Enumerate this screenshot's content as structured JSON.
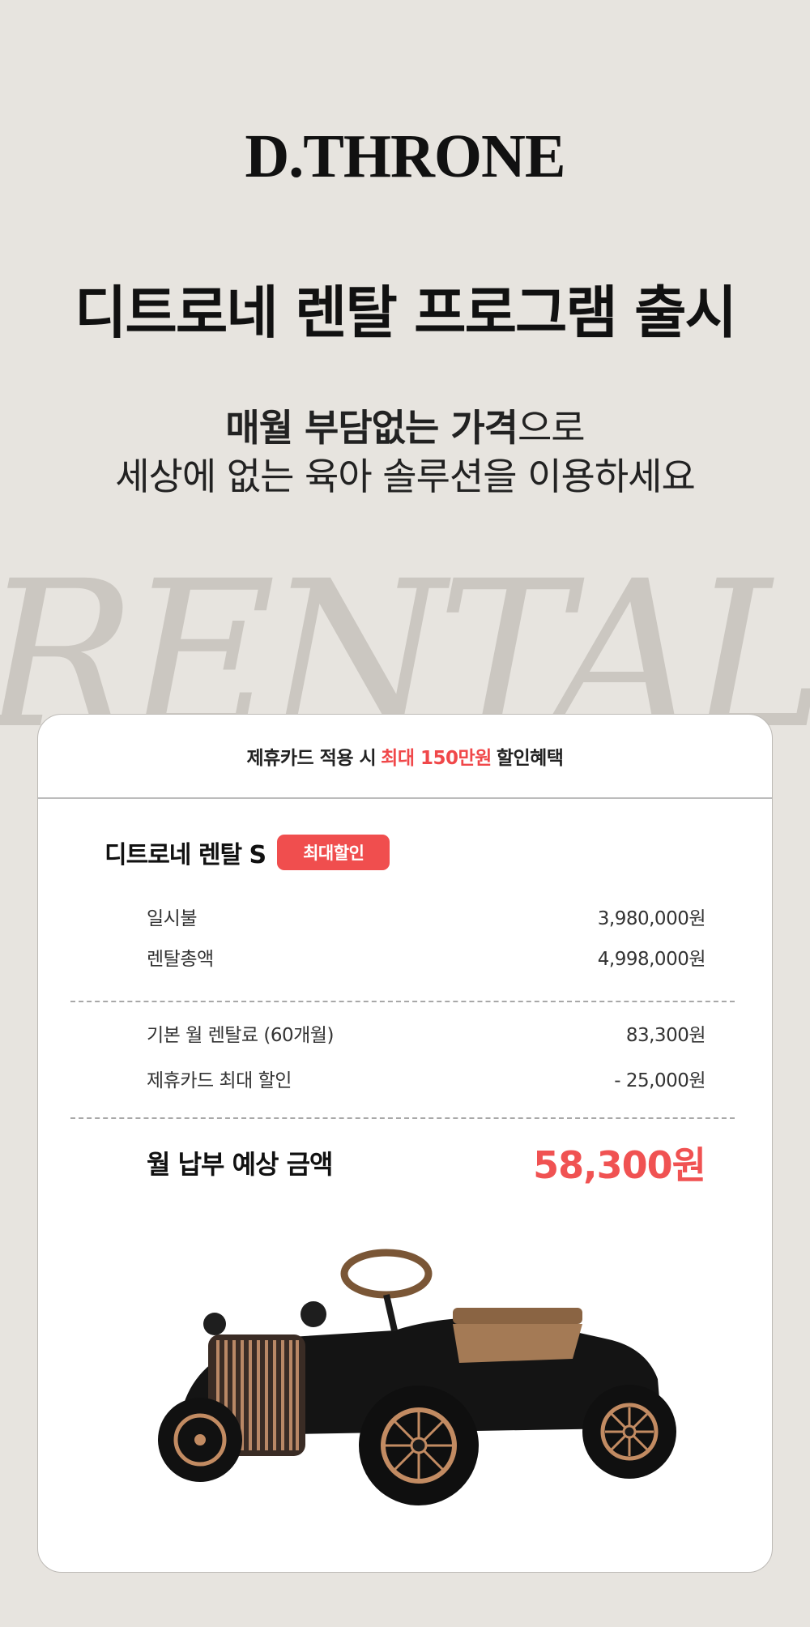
{
  "brand": "D.THRONE",
  "headline": "디트로네 렌탈 프로그램 출시",
  "subheadline": {
    "bold": "매월 부담없는 가격",
    "normal": "으로",
    "line2": "세상에 없는 육아 솔루션을 이용하세요"
  },
  "script_text": "RENTAL",
  "card": {
    "banner": {
      "prefix": "제휴카드 적용 시",
      "highlight": "최대 150만원",
      "suffix": "할인혜택"
    },
    "plan_name": "디트로네 렌탈 S",
    "badge": "최대할인",
    "rows": [
      {
        "label": "일시불",
        "value": "3,980,000원"
      },
      {
        "label": "렌탈총액",
        "value": "4,998,000원"
      },
      {
        "label": "기본 월 렌탈료 (60개월)",
        "value": "83,300원"
      },
      {
        "label": "제휴카드 최대 할인",
        "value": "- 25,000원"
      }
    ],
    "total_label": "월 납부 예상 금액",
    "total_value": "58,300원"
  },
  "colors": {
    "background": "#e7e4df",
    "accent": "#f04e4e"
  }
}
